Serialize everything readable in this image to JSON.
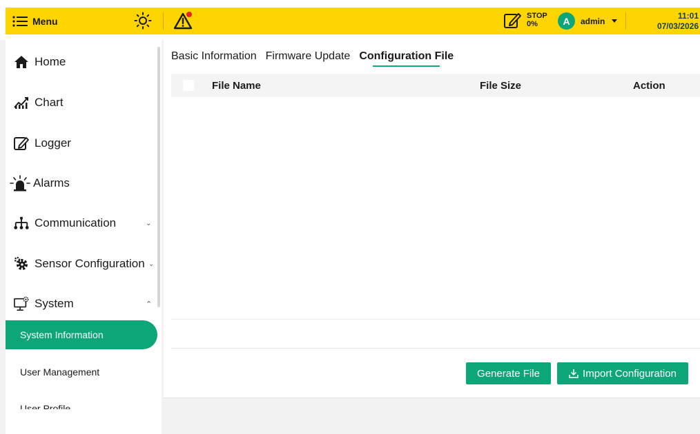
{
  "header": {
    "menu_label": "Menu",
    "status": {
      "label": "STOP",
      "percent": "0%"
    },
    "user": {
      "initial": "A",
      "name": "admin"
    },
    "clock": {
      "time": "11:01",
      "date": "07/03/2026"
    }
  },
  "sidebar": {
    "items": [
      {
        "label": "Home",
        "icon": "home-icon"
      },
      {
        "label": "Chart",
        "icon": "chart-icon"
      },
      {
        "label": "Logger",
        "icon": "edit-icon"
      },
      {
        "label": "Alarms",
        "icon": "alarm-icon"
      },
      {
        "label": "Communication",
        "icon": "network-icon",
        "chevron": "down"
      },
      {
        "label": "Sensor Configuration",
        "icon": "gears-icon",
        "chevron": "down"
      },
      {
        "label": "System",
        "icon": "monitor-gear-icon",
        "chevron": "up"
      }
    ],
    "sub_items": [
      {
        "label": "System Information",
        "active": true
      },
      {
        "label": "User Management",
        "active": false
      },
      {
        "label": "User Profile",
        "active": false
      }
    ]
  },
  "tabs": [
    {
      "label": "Basic Information",
      "active": false
    },
    {
      "label": "Firmware Update",
      "active": false
    },
    {
      "label": "Configuration File",
      "active": true
    }
  ],
  "table": {
    "headers": [
      "File Name",
      "File Size",
      "Action"
    ],
    "rows": []
  },
  "buttons": {
    "generate": "Generate File",
    "import": "Import Configuration"
  },
  "colors": {
    "header_bg": "#ffd500",
    "accent": "#0da678",
    "alert_dot": "#e8202a",
    "clock_text": "#14405e"
  }
}
